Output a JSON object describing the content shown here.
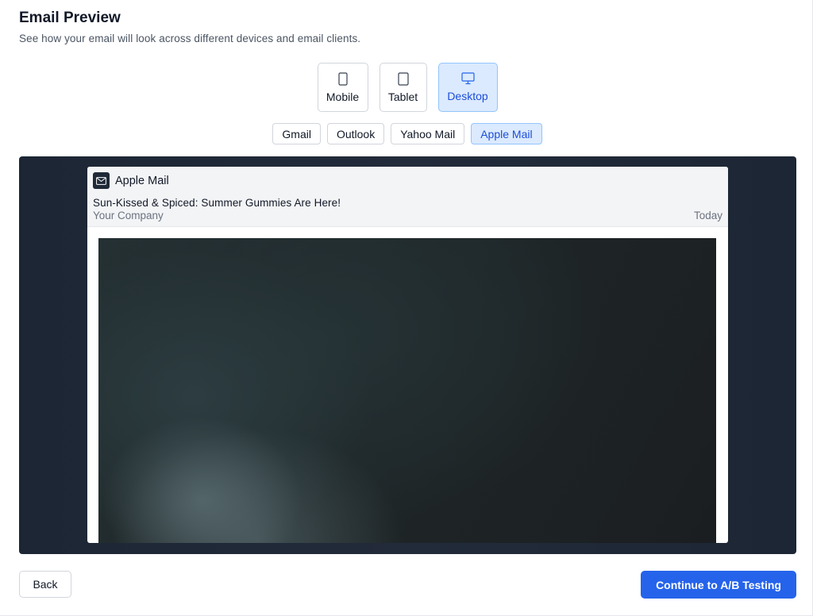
{
  "header": {
    "title": "Email Preview",
    "subtitle": "See how your email will look across different devices and email clients."
  },
  "devices": [
    {
      "label": "Mobile",
      "icon": "smartphone-icon",
      "active": false
    },
    {
      "label": "Tablet",
      "icon": "tablet-icon",
      "active": false
    },
    {
      "label": "Desktop",
      "icon": "monitor-icon",
      "active": true
    }
  ],
  "clients": [
    {
      "label": "Gmail",
      "active": false
    },
    {
      "label": "Outlook",
      "active": false
    },
    {
      "label": "Yahoo Mail",
      "active": false
    },
    {
      "label": "Apple Mail",
      "active": true
    }
  ],
  "preview": {
    "client_name": "Apple Mail",
    "client_icon": "mail-icon",
    "subject": "Sun-Kissed & Spiced: Summer Gummies Are Here!",
    "sender": "Your Company",
    "date": "Today"
  },
  "footer": {
    "back_label": "Back",
    "continue_label": "Continue to A/B Testing"
  },
  "colors": {
    "accent": "#2563eb",
    "active_bg": "#dbeafe",
    "active_text": "#1d4ed8",
    "stage_bg": "#1f2937"
  }
}
